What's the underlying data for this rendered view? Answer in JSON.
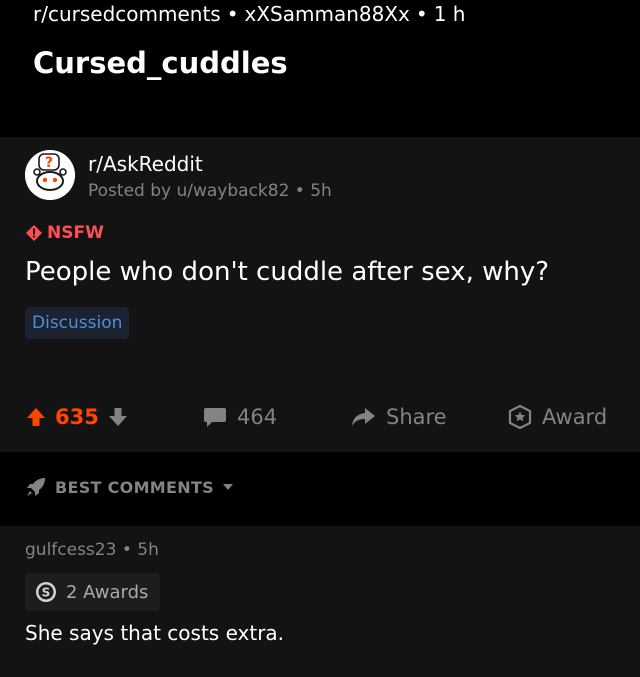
{
  "header": {
    "subreddit": "r/cursedcomments",
    "author": "xXSamman88Xx",
    "age": "1 h",
    "separator": "•",
    "title": "Cursed_cuddles"
  },
  "post": {
    "subreddit": "r/AskReddit",
    "posted_by": "Posted by u/wayback82 • 5h",
    "nsfw_label": "NSFW",
    "title": "People who don't cuddle after sex, why?",
    "flair": "Discussion",
    "score": "635",
    "comments": "464",
    "share_label": "Share",
    "award_label": "Award"
  },
  "sort": {
    "label": "BEST COMMENTS"
  },
  "comment": {
    "author_line": "gulfcess23 • 5h",
    "awards_label": "2 Awards",
    "body": "She says that costs extra."
  },
  "colors": {
    "upvote": "#ff4500",
    "nsfw": "#ff4f55",
    "flair_text": "#4f8fd8",
    "muted": "#818384"
  },
  "icons": [
    "question-avatar-icon",
    "nsfw-diamond-icon",
    "upvote-icon",
    "downvote-icon",
    "comment-icon",
    "share-icon",
    "award-icon",
    "rocket-icon",
    "caret-down-icon",
    "silver-award-icon"
  ]
}
